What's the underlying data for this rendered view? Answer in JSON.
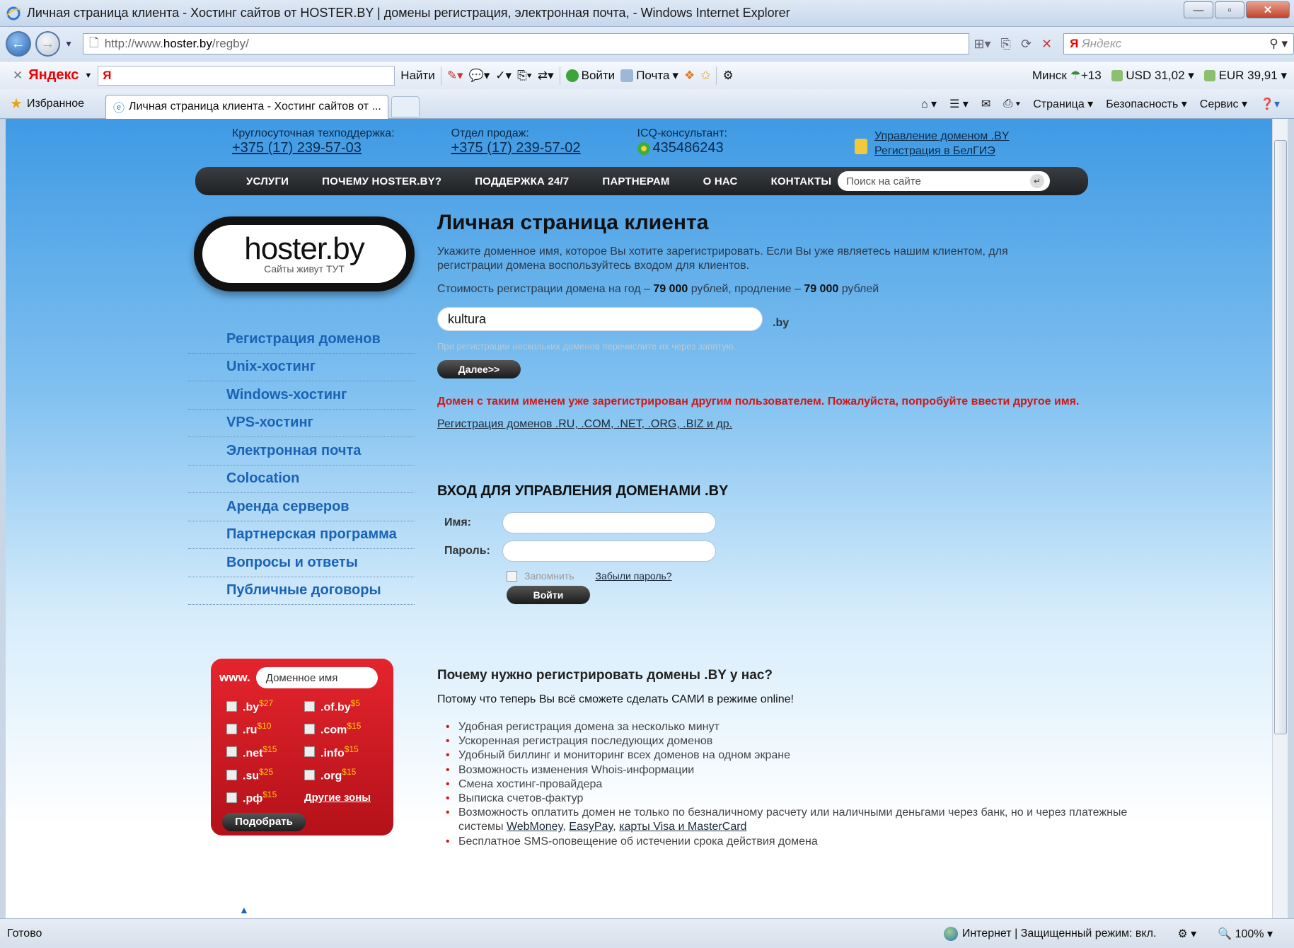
{
  "window": {
    "title": "Личная страница клиента - Хостинг сайтов от HOSTER.BY | домены регистрация, электронная почта,  - Windows Internet Explorer",
    "address": {
      "prefix": "http://www.",
      "host": "hoster.by",
      "path": "/regby/"
    },
    "search_placeholder": "Яндекс"
  },
  "yandex_bar": {
    "brand": "Яндекс",
    "logo_letter": "Я",
    "find": "Найти",
    "login": "Войти",
    "mail": "Почта",
    "city": "Минск",
    "temp": "+13",
    "usd": "USD 31,02",
    "eur": "EUR 39,91"
  },
  "tabs_bar": {
    "favorites": "Избранное",
    "tab_title": "Личная страница клиента - Хостинг сайтов от ...",
    "page": "Страница",
    "safety": "Безопасность",
    "service": "Сервис"
  },
  "header": {
    "support_label": "Круглосуточная техподдержка:",
    "support_phone": "+375 (17) 239-57-03",
    "sales_label": "Отдел продаж:",
    "sales_phone": "+375 (17) 239-57-02",
    "icq_label": "ICQ-консультант:",
    "icq_number": "435486243",
    "manage_link": "Управление доменом .BY",
    "belgie_link": "Регистрация в БелГИЭ"
  },
  "nav": {
    "items": [
      "УСЛУГИ",
      "ПОЧЕМУ HOSTER.BY?",
      "ПОДДЕРЖКА 24/7",
      "ПАРТНЕРАМ",
      "О НАС",
      "КОНТАКТЫ"
    ],
    "search_placeholder": "Поиск на сайте"
  },
  "logo": {
    "brand": "hoster.by",
    "tagline": "Сайты живут ТУТ"
  },
  "sidebar": {
    "items": [
      "Регистрация доменов",
      "Unix-хостинг",
      "Windows-хостинг",
      "VPS-хостинг",
      "Электронная почта",
      "Colocation",
      "Аренда серверов",
      "Партнерская программа",
      "Вопросы и ответы",
      "Публичные договоры"
    ]
  },
  "domain_box": {
    "www": "www.",
    "placeholder": "Доменное имя",
    "zones": [
      {
        "name": ".by",
        "price": "$27"
      },
      {
        "name": ".of.by",
        "price": "$5"
      },
      {
        "name": ".ru",
        "price": "$10"
      },
      {
        "name": ".com",
        "price": "$15"
      },
      {
        "name": ".net",
        "price": "$15"
      },
      {
        "name": ".info",
        "price": "$15"
      },
      {
        "name": ".su",
        "price": "$25"
      },
      {
        "name": ".org",
        "price": "$15"
      },
      {
        "name": ".рф",
        "price": "$15"
      }
    ],
    "other_zones": "Другие зоны",
    "pick_button": "Подобрать"
  },
  "main": {
    "title": "Личная страница клиента",
    "intro": "Укажите доменное имя, которое Вы хотите зарегистрировать. Если Вы уже являетесь нашим клиентом, для регистрации домена воспользуйтесь входом для клиентов.",
    "price_prefix": "Стоимость регистрации домена на год – ",
    "price_reg": "79 000",
    "price_mid": " рублей, продление – ",
    "price_renew": "79 000",
    "price_suffix": " рублей",
    "domain_value": "kultura",
    "tld": ".by",
    "hint": "При регистрации нескольких доменов перечислите их через запятую.",
    "next_button": "Далее>>",
    "error": "Домен с таким именем уже зарегистрирован другим пользователем. Пожалуйста, попробуйте ввести другое имя.",
    "reg_link": "Регистрация доменов .RU, .COM, .NET, .ORG, .BIZ и др."
  },
  "login": {
    "title": "ВХОД ДЛЯ УПРАВЛЕНИЯ ДОМЕНАМИ .BY",
    "name_label": "Имя:",
    "password_label": "Пароль:",
    "remember": "Запомнить",
    "forgot": "Забыли пароль?",
    "button": "Войти"
  },
  "why": {
    "title": "Почему нужно регистрировать домены .BY у нас?",
    "subtitle": "Потому что теперь Вы всё сможете сделать САМИ в режиме online!",
    "items": [
      "Удобная регистрация домена за несколько минут",
      "Ускоренная регистрация последующих доменов",
      "Удобный биллинг и мониторинг всех доменов на одном экране",
      "Возможность изменения Whois-информации",
      "Смена хостинг-провайдера",
      "Выписка счетов-фактур"
    ],
    "payment_text": "Возможность оплатить домен не только по безналичному расчету или наличными деньгами через банк, но и через платежные системы ",
    "payment_webmoney": "WebMoney",
    "payment_easypay": "EasyPay",
    "payment_cards": "карты Visa и MasterCard",
    "sms_item": "Бесплатное SMS-оповещение об истечении срока действия домена"
  },
  "status": {
    "ready": "Готово",
    "zone": "Интернет | Защищенный режим: вкл.",
    "zoom": "100%"
  },
  "colors": {
    "accent_blue": "#1a63b5",
    "error_red": "#d01818",
    "promo_red": "#e5242d"
  }
}
